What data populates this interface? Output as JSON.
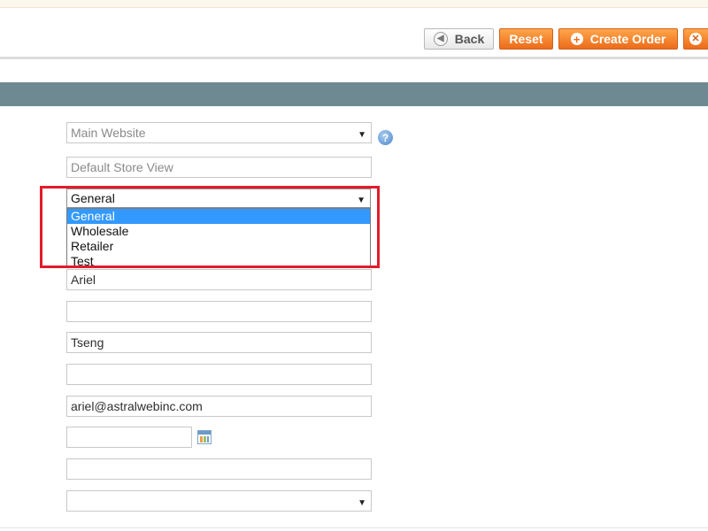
{
  "toolbar": {
    "back_label": "Back",
    "reset_label": "Reset",
    "create_order_label": "Create Order"
  },
  "form": {
    "website": {
      "value": "Main Website"
    },
    "store_view": {
      "value": "Default Store View"
    },
    "customer_group": {
      "value": "General",
      "options": [
        "General",
        "Wholesale",
        "Retailer",
        "Test"
      ],
      "highlighted_option": "General"
    },
    "first_name": {
      "value": "Ariel"
    },
    "middle_name": {
      "value": ""
    },
    "last_name": {
      "value": "Tseng"
    },
    "suffix": {
      "value": ""
    },
    "email": {
      "value": "ariel@astralwebinc.com"
    },
    "date_of_birth": {
      "value": ""
    },
    "tax_vat": {
      "value": ""
    },
    "gender": {
      "value": ""
    }
  },
  "colors": {
    "accent_orange": "#ec6b1b",
    "section_bar": "#6f8992",
    "highlight_red": "#e21c2a",
    "selected_option": "#3399ff"
  },
  "icons": {
    "back": "back-arrow-icon",
    "create": "plus-icon",
    "cancel": "close-icon",
    "help": "help-icon",
    "calendar": "calendar-icon"
  }
}
